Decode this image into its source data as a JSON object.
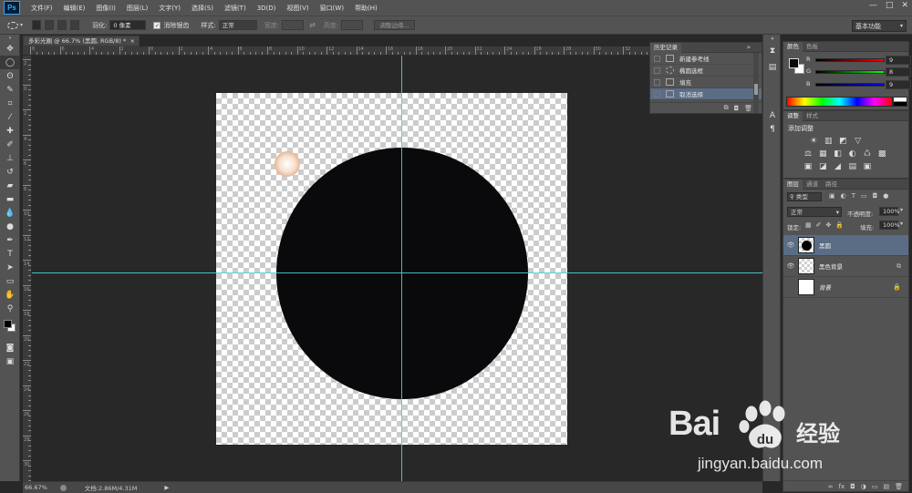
{
  "app": {
    "logo": "Ps"
  },
  "menubar": {
    "items": [
      "文件(F)",
      "编辑(E)",
      "图像(I)",
      "图层(L)",
      "文字(Y)",
      "选择(S)",
      "滤镜(T)",
      "3D(D)",
      "视图(V)",
      "窗口(W)",
      "帮助(H)"
    ],
    "window_controls": [
      "—",
      "□",
      "✕"
    ]
  },
  "options": {
    "feather_label": "羽化:",
    "feather_value": "0 像素",
    "antialias_label": "消除锯齿",
    "style_label": "样式:",
    "style_value": "正常",
    "width_label": "宽度:",
    "height_label": "高度:",
    "refine_edge": "调整边缘...",
    "workspace": "基本功能"
  },
  "document": {
    "tab_title": "多彩光圈 @ 66.7% (黑圆, RGB/8) *",
    "tab_close": "×",
    "ruler_top_labels": [
      "8",
      "6",
      "4",
      "2",
      "0",
      "2",
      "4",
      "6",
      "8",
      "10",
      "12",
      "14",
      "16",
      "18",
      "20",
      "22",
      "24",
      "26",
      "28",
      "30",
      "32",
      "34",
      "36",
      "38",
      "40"
    ],
    "ruler_left_labels": [
      "2",
      "0",
      "2",
      "4",
      "6",
      "8",
      "10",
      "12",
      "14",
      "16",
      "18",
      "20",
      "22",
      "24",
      "26",
      "28",
      "30"
    ]
  },
  "status": {
    "zoom": "66.67%",
    "doc_info": "文档:2.86M/4.31M",
    "arrow": "▶"
  },
  "history": {
    "title": "历史记录",
    "collapse": "»",
    "items": [
      {
        "label": "新建参考线"
      },
      {
        "label": "椭圆选框"
      },
      {
        "label": "填充"
      },
      {
        "label": "取消选择"
      }
    ]
  },
  "color_panel": {
    "tabs": [
      "颜色",
      "色板"
    ],
    "channels": [
      {
        "label": "R",
        "value": "9",
        "color": "#ff3b3b"
      },
      {
        "label": "G",
        "value": "8",
        "color": "#3bff3b"
      },
      {
        "label": "B",
        "value": "9",
        "color": "#3b6bff"
      }
    ],
    "foreground": "#09080a",
    "background": "#ffffff"
  },
  "adjust_panel": {
    "tabs": [
      "调整",
      "样式"
    ],
    "title": "添加调整",
    "row1": [
      "☀",
      "▥",
      "◩",
      "▽"
    ],
    "row2": [
      "⚖",
      "▦",
      "◧",
      "◐",
      "♺",
      "▩"
    ],
    "row3": [
      "▣",
      "◪",
      "◢",
      "▤",
      "▣"
    ]
  },
  "layers_panel": {
    "tabs": [
      "图层",
      "通道",
      "路径"
    ],
    "filter_label": "类型",
    "blend_mode": "正常",
    "opacity_label": "不透明度:",
    "opacity_value": "100%",
    "lock_label": "锁定:",
    "fill_label": "填充:",
    "fill_value": "100%",
    "layers": [
      {
        "name": "黑圆",
        "selected": true,
        "visible": true
      },
      {
        "name": "黑色背景",
        "selected": false,
        "visible": true
      },
      {
        "name": "背景",
        "selected": false,
        "visible": false
      }
    ],
    "footer_icons": [
      "∞",
      "fx",
      "◘",
      "◑",
      "▭",
      "▤",
      "🗑"
    ]
  },
  "watermark": {
    "brand": "Bai",
    "brand_suffix": "经验",
    "url": "jingyan.baidu.com"
  }
}
